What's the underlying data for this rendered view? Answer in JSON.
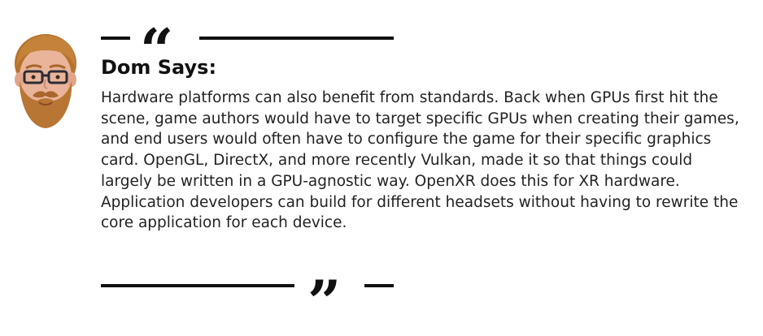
{
  "speaker": {
    "name": "Dom Says:",
    "avatar_icon": "bearded-man-with-glasses-avatar"
  },
  "quote": {
    "open_mark": "“",
    "close_mark": "”",
    "body": "Hardware platforms can also benefit from standards. Back when GPUs first hit the scene, game authors would have to target specific GPUs when creating their games, and end users would often have to configure the game for their specific graphics card. OpenGL, DirectX, and more recently Vulkan, made it so that things could largely be written in a GPU-agnostic way. OpenXR does this for XR hardware. Application developers can build for different headsets without having to rewrite the core application for each device."
  },
  "colors": {
    "text": "#222222",
    "rules": "#111111",
    "background": "#ffffff"
  }
}
